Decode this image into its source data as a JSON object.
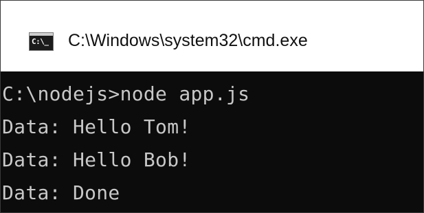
{
  "window": {
    "title": "C:\\Windows\\system32\\cmd.exe",
    "icon": "cmd-icon",
    "icon_text": "C:\\_"
  },
  "console": {
    "lines": [
      "C:\\nodejs>node app.js",
      "Data: Hello Tom!",
      "Data: Hello Bob!",
      "Data: Done"
    ]
  },
  "colors": {
    "console_bg": "#0c0c0c",
    "console_fg": "#c8c8c8",
    "titlebar_bg": "#ffffff"
  }
}
